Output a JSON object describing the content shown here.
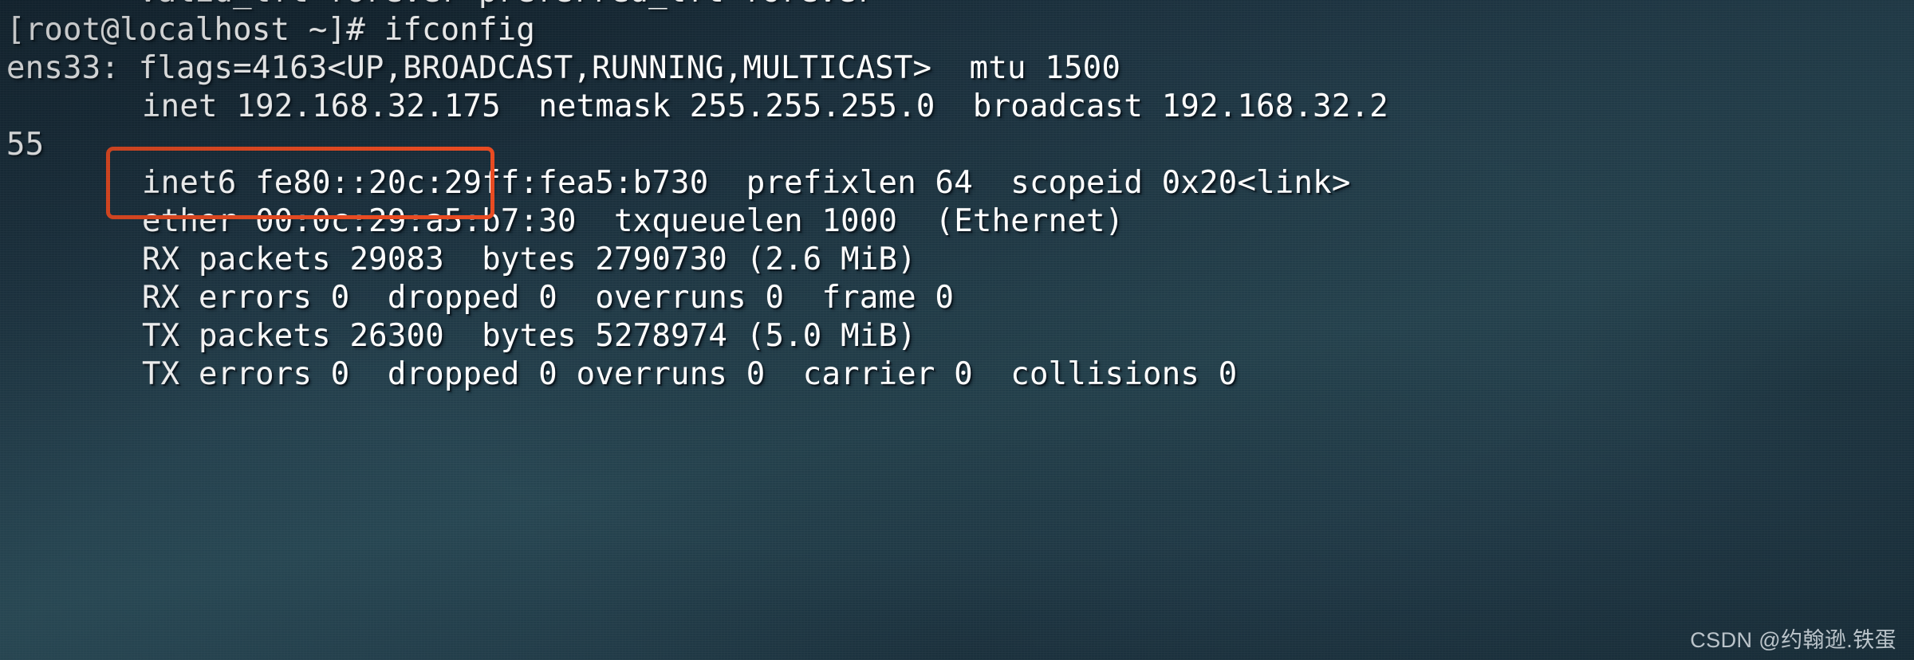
{
  "terminal": {
    "shell_prompt": "[root@localhost ~]# ",
    "command": "ifconfig",
    "colors": {
      "background_dark": "#233d4d",
      "background_light": "#37616f",
      "text": "#ffffff",
      "annotation": "#e8491f"
    },
    "lines": [
      {
        "id": "l0",
        "text": "       valid_lft forever preferred_lft forever",
        "indent": false,
        "clipped": true
      },
      {
        "id": "l1",
        "text": "[root@localhost ~]# ifconfig",
        "indent": false
      },
      {
        "id": "l2",
        "text": "ens33: flags=4163<UP,BROADCAST,RUNNING,MULTICAST>  mtu 1500",
        "indent": false
      },
      {
        "id": "l3",
        "text": "inet 192.168.32.175  netmask 255.255.255.0  broadcast 192.168.32.2",
        "indent": true,
        "highlighted": true
      },
      {
        "id": "l4",
        "text": "55",
        "indent": false,
        "wrapped": true
      },
      {
        "id": "l5",
        "text": "inet6 fe80::20c:29ff:fea5:b730  prefixlen 64  scopeid 0x20<link>",
        "indent": true
      },
      {
        "id": "l6",
        "text": "ether 00:0c:29:a5:b7:30  txqueuelen 1000  (Ethernet)",
        "indent": true
      },
      {
        "id": "l7",
        "text": "RX packets 29083  bytes 2790730 (2.6 MiB)",
        "indent": true
      },
      {
        "id": "l8",
        "text": "RX errors 0  dropped 0  overruns 0  frame 0",
        "indent": true
      },
      {
        "id": "l9",
        "text": "TX packets 26300  bytes 5278974 (5.0 MiB)",
        "indent": true
      },
      {
        "id": "l10",
        "text": "TX errors 0  dropped 0 overruns 0  carrier 0  collisions 0",
        "indent": true
      }
    ],
    "interface": {
      "name": "ens33",
      "flags_value": "4163",
      "flags": [
        "UP",
        "BROADCAST",
        "RUNNING",
        "MULTICAST"
      ],
      "mtu": "1500",
      "inet": "192.168.32.175",
      "netmask": "255.255.255.0",
      "broadcast": "192.168.32.255",
      "inet6": "fe80::20c:29ff:fea5:b730",
      "prefixlen": "64",
      "scopeid": "0x20<link>",
      "ether": "00:0c:29:a5:b7:30",
      "txqueuelen": "1000",
      "link_type": "Ethernet",
      "rx_packets": "29083",
      "rx_bytes": "2790730",
      "rx_bytes_human": "2.6 MiB",
      "rx_errors": "0",
      "rx_dropped": "0",
      "rx_overruns": "0",
      "rx_frame": "0",
      "tx_packets": "26300",
      "tx_bytes": "5278974",
      "tx_bytes_human": "5.0 MiB",
      "tx_errors": "0",
      "tx_dropped": "0",
      "tx_overruns": "0",
      "tx_carrier": "0",
      "tx_collisions": "0"
    }
  },
  "watermark": {
    "text": "CSDN @约翰逊.铁蛋"
  }
}
